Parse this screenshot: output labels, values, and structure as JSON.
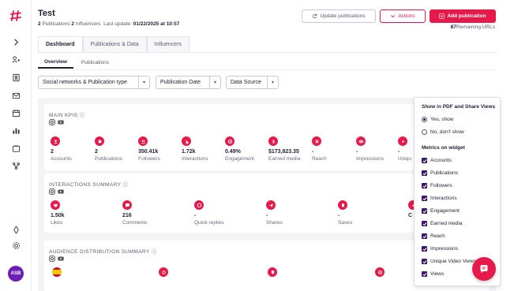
{
  "colors": {
    "accent": "#e6194b",
    "sidebar_avatar": "#6a1fb5",
    "check": "#3b1a6b"
  },
  "sidebar": {
    "logo": "hashtag-logo-icon",
    "items": [
      "chevron-right-icon",
      "influencers-icon",
      "contacts-icon",
      "messages-icon",
      "calendar-icon",
      "analytics-icon",
      "media-icon",
      "integrations-icon"
    ],
    "bottom_items": [
      "tools-icon",
      "settings-icon"
    ],
    "avatar_text": "ASB"
  },
  "header": {
    "title": "Test",
    "publications_count": "2",
    "publications_label": "Publications",
    "influencers_count": "2",
    "influencers_label": "Influencers",
    "last_update_label": "Last update:",
    "last_update_value": "01/22/2025 at 10:57",
    "update_button": "Update publications",
    "actions_button": "Actions",
    "add_button": "Add publication",
    "remaining_count": "87",
    "remaining_label": "Remaining URLs"
  },
  "tabs": [
    "Dashboard",
    "Publications & Data",
    "Influencers"
  ],
  "subtabs": [
    "Overview",
    "Publications"
  ],
  "filters": [
    "Social networks & Publication type",
    "Publication Date",
    "Data Source"
  ],
  "main_kpis": {
    "title": "MAIN KPIS",
    "metrics": [
      {
        "value": "2",
        "label": "Accounts",
        "icon": "account-icon"
      },
      {
        "value": "2",
        "label": "Publications",
        "icon": "publication-icon"
      },
      {
        "value": "350.41k",
        "label": "Followers",
        "icon": "followers-icon"
      },
      {
        "value": "1.72k",
        "label": "Interactions",
        "icon": "interactions-icon"
      },
      {
        "value": "0.49%",
        "label": "Engagement",
        "icon": "engagement-icon"
      },
      {
        "value": "$173,823.35",
        "label": "Earned media",
        "icon": "dollar-icon"
      },
      {
        "value": "-",
        "label": "Reach",
        "icon": "reach-icon"
      },
      {
        "value": "-",
        "label": "Impressions",
        "icon": "eye-icon"
      },
      {
        "value": "-",
        "label": "Uniqu",
        "icon": "play-icon"
      }
    ]
  },
  "interactions_summary": {
    "title": "INTERACTIONS SUMMARY",
    "metrics": [
      {
        "value": "1.50k",
        "label": "Likes",
        "icon": "heart-icon"
      },
      {
        "value": "216",
        "label": "Comments",
        "icon": "comment-icon"
      },
      {
        "value": "-",
        "label": "Quick replies",
        "icon": "quick-reply-icon"
      },
      {
        "value": "-",
        "label": "Shares",
        "icon": "share-icon"
      },
      {
        "value": "-",
        "label": "Saves",
        "icon": "bookmark-icon"
      },
      {
        "value": "C",
        "label": "",
        "icon": "more-icon"
      }
    ]
  },
  "audience_distribution": {
    "title": "AUDIENCE DISTRIBUTION SUMMARY"
  },
  "panel": {
    "pdf_heading": "Show in PDF and Share Views",
    "option_yes": "Yes, show",
    "option_no": "No, don't show",
    "metrics_heading": "Metrics on widget",
    "metrics": [
      "Accounts",
      "Publications",
      "Followers",
      "Interactions",
      "Engagement",
      "Earned media",
      "Reach",
      "Impressions",
      "Unique Video Views",
      "Views"
    ]
  },
  "chat_button": "chat-icon"
}
